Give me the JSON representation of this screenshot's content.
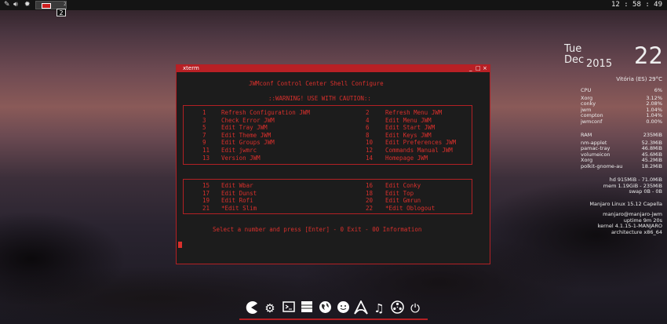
{
  "top_panel": {
    "icons": [
      "pen-icon",
      "volume-icon",
      "settings-icon"
    ],
    "task_window": "xterm",
    "workspace_next": "2",
    "workspace_badge": "2",
    "clock": "12 : 58 : 49"
  },
  "conky": {
    "day": "Tue",
    "month": "Dec",
    "year": "2015",
    "date": "22",
    "location": "Vitória (ES) 29°C",
    "cpu": {
      "label": "CPU",
      "value": "6%"
    },
    "cpu_procs": [
      {
        "name": "Xorg",
        "value": "3.12%"
      },
      {
        "name": "conky",
        "value": "2.08%"
      },
      {
        "name": "jwm",
        "value": "1.04%"
      },
      {
        "name": "compton",
        "value": "1.04%"
      },
      {
        "name": "jwmconf",
        "value": "0.00%"
      }
    ],
    "ram": {
      "label": "RAM",
      "value": "235MiB"
    },
    "ram_procs": [
      {
        "name": "nm-applet",
        "value": "52.3MiB"
      },
      {
        "name": "pamac-tray",
        "value": "46.8MiB"
      },
      {
        "name": "volumeicon",
        "value": "45.6MiB"
      },
      {
        "name": "Xorg",
        "value": "45.2MiB"
      },
      {
        "name": "polkit-gnome-au",
        "value": "18.2MiB"
      }
    ],
    "hd": "hd 915MiB - 71.0MiB",
    "mem": "mem 1.19GiB - 235MiB",
    "swap": "swap 0B  - 0B",
    "distro": "Manjaro Linux 15.12 Capella",
    "user": "manjaro@manjaro-jwm",
    "uptime": "uptime 9m 20s",
    "kernel": "kernel 4.1.15-1-MANJARO",
    "arch": "architecture x86_64"
  },
  "xterm": {
    "title": "xterm",
    "btn_min": "_",
    "btn_max": "□",
    "btn_close": "×",
    "heading": "JWMconf Control Center Shell Configure",
    "warning": "::WARNING! USE WITH CAUTION::",
    "menu_top": [
      {
        "num": "1",
        "label": "Refresh Configuration JWM",
        "num2": "2",
        "label2": "Refresh Menu JWM"
      },
      {
        "num": "3",
        "label": "Check Error JWM",
        "num2": "4",
        "label2": "Edit Menu JWM"
      },
      {
        "num": "5",
        "label": "Edit Tray JWM",
        "num2": "6",
        "label2": "Edit Start JWM"
      },
      {
        "num": "7",
        "label": "Edit Theme JWM",
        "num2": "8",
        "label2": "Edit Keys JWM"
      },
      {
        "num": "9",
        "label": "Edit Groups JWM",
        "num2": "10",
        "label2": "Edit Preferences JWM"
      },
      {
        "num": "11",
        "label": "Edit jwmrc",
        "num2": "12",
        "label2": "Commands Manual JWM"
      },
      {
        "num": "13",
        "label": "Version JWM",
        "num2": "14",
        "label2": "Homepage JWM"
      }
    ],
    "menu_bottom": [
      {
        "num": "15",
        "label": "Edit Wbar",
        "num2": "16",
        "label2": "Edit Conky"
      },
      {
        "num": "17",
        "label": "Edit Dunst",
        "num2": "18",
        "label2": "Edit Top"
      },
      {
        "num": "19",
        "label": "Edit Rofi",
        "num2": "20",
        "label2": "Edit Gmrun"
      },
      {
        "num": "21",
        "label": "*Edit Slim",
        "num2": "22",
        "label2": "*Edit Oblogout"
      }
    ],
    "prompt": "Select a number and press [Enter] - 0 Exit - 00 Information"
  },
  "dock": {
    "items": [
      "pacman-icon",
      "settings-gear-icon",
      "terminal-icon",
      "file-manager-icon",
      "web-browser-icon",
      "chat-icon",
      "arch-icon",
      "music-icon",
      "media-reel-icon",
      "power-icon"
    ]
  },
  "colors": {
    "accent": "#b82025",
    "terminal_text": "#d9302c",
    "terminal_bg": "#1c1c1c",
    "panel_bg": "#141414"
  }
}
